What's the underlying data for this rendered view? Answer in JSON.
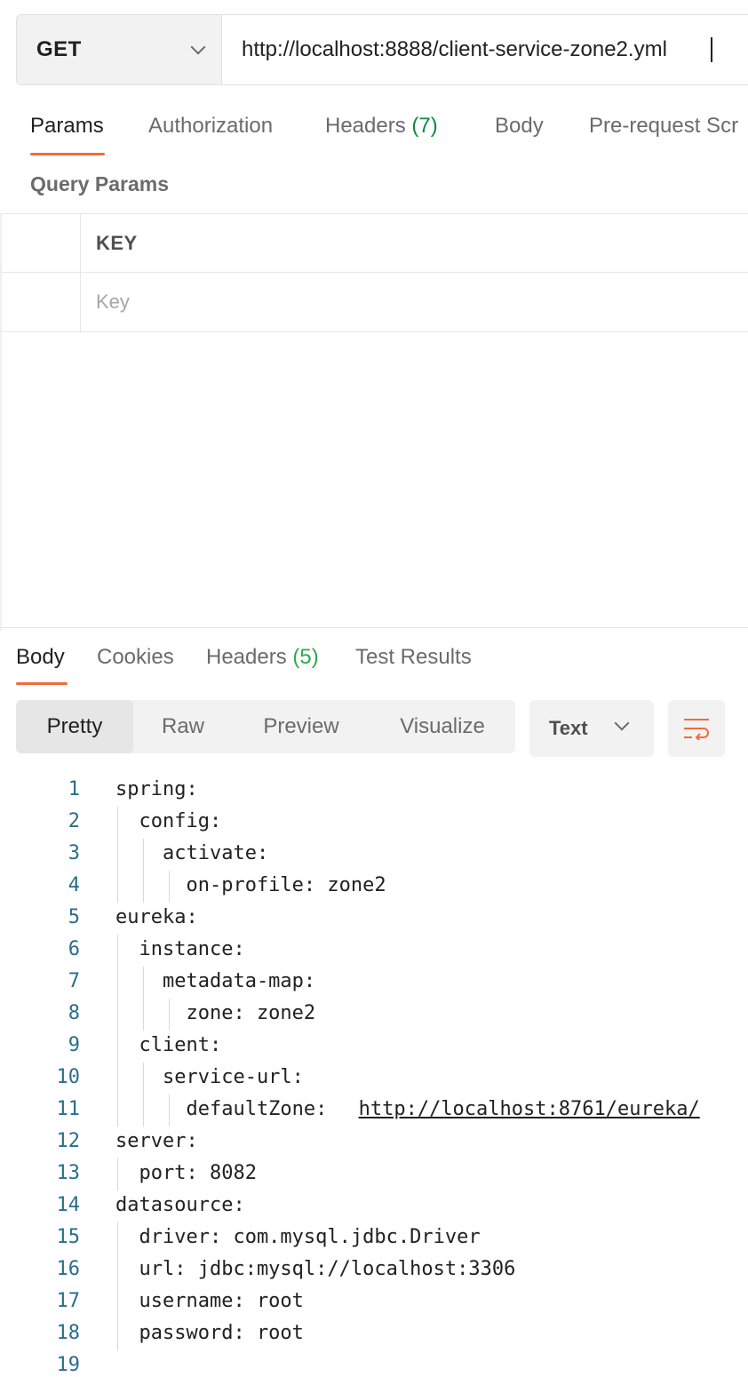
{
  "request": {
    "method": "GET",
    "url": "http://localhost:8888/client-service-zone2.yml"
  },
  "request_tabs": {
    "params": "Params",
    "authorization": "Authorization",
    "headers": "Headers",
    "headers_count": "(7)",
    "body": "Body",
    "pre_request": "Pre-request Scr"
  },
  "query_params": {
    "title": "Query Params",
    "key_header": "KEY",
    "key_placeholder": "Key"
  },
  "response_tabs": {
    "body": "Body",
    "cookies": "Cookies",
    "headers": "Headers",
    "headers_count": "(5)",
    "test_results": "Test Results"
  },
  "view": {
    "pretty": "Pretty",
    "raw": "Raw",
    "preview": "Preview",
    "visualize": "Visualize",
    "format": "Text"
  },
  "code_lines": [
    {
      "n": "1",
      "t": "spring:"
    },
    {
      "n": "2",
      "t": "  config:"
    },
    {
      "n": "3",
      "t": "    activate:"
    },
    {
      "n": "4",
      "t": "      on-profile: zone2"
    },
    {
      "n": "5",
      "t": "eureka:"
    },
    {
      "n": "6",
      "t": "  instance:"
    },
    {
      "n": "7",
      "t": "    metadata-map:"
    },
    {
      "n": "8",
      "t": "      zone: zone2"
    },
    {
      "n": "9",
      "t": "  client:"
    },
    {
      "n": "10",
      "t": "    service-url:"
    },
    {
      "n": "11",
      "t": "      defaultZone: ",
      "link": "http://localhost:8761/eureka/"
    },
    {
      "n": "12",
      "t": "server:"
    },
    {
      "n": "13",
      "t": "  port: 8082"
    },
    {
      "n": "14",
      "t": "datasource:"
    },
    {
      "n": "15",
      "t": "  driver: com.mysql.jdbc.Driver"
    },
    {
      "n": "16",
      "t": "  url: jdbc:mysql://localhost:3306"
    },
    {
      "n": "17",
      "t": "  username: root"
    },
    {
      "n": "18",
      "t": "  password: root"
    },
    {
      "n": "19",
      "t": ""
    }
  ],
  "colors": {
    "accent": "#f26b3a",
    "count_green": "#0f8a3f",
    "line_number": "#2b6d8c"
  }
}
